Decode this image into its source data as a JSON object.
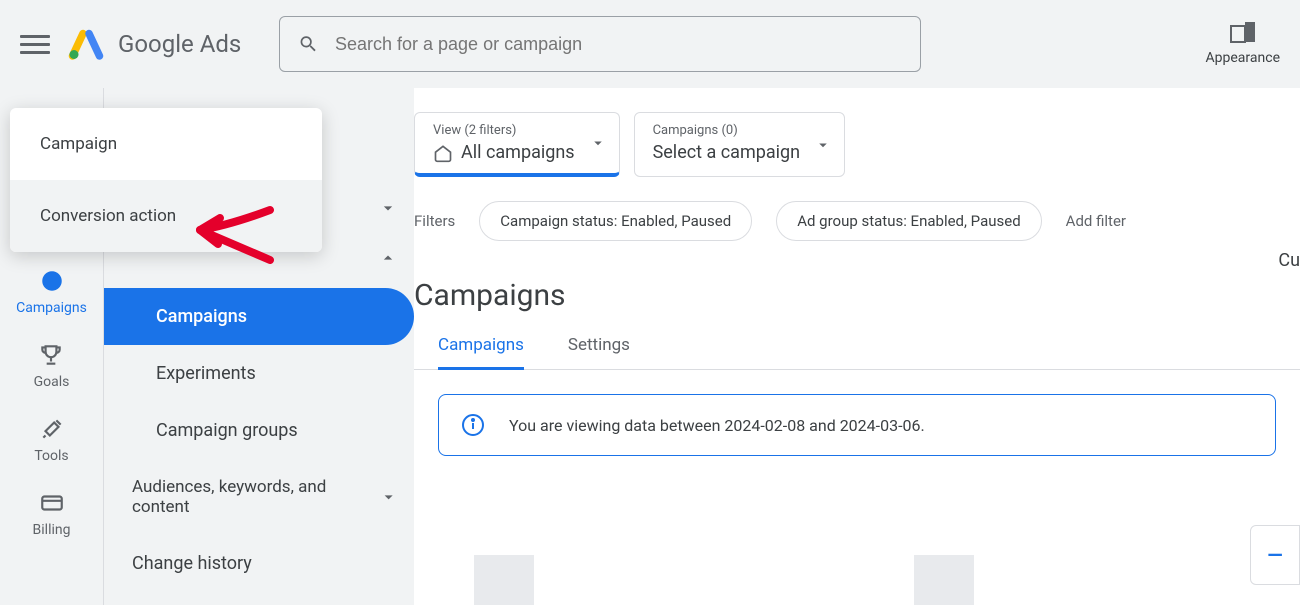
{
  "header": {
    "product_name": "Google Ads",
    "search_placeholder": "Search for a page or campaign",
    "appearance_label": "Appearance"
  },
  "iconrail": {
    "campaigns": "Campaigns",
    "goals": "Goals",
    "tools": "Tools",
    "billing": "Billing"
  },
  "secondnav": {
    "campaigns": "Campaigns",
    "experiments": "Experiments",
    "campaign_groups": "Campaign groups",
    "audiences": "Audiences, keywords, and content",
    "change_history": "Change history"
  },
  "popup": {
    "item1": "Campaign",
    "item2": "Conversion action"
  },
  "view_card": {
    "small": "View (2 filters)",
    "big": "All campaigns"
  },
  "campaign_card": {
    "small": "Campaigns (0)",
    "big": "Select a campaign"
  },
  "filters": {
    "label": "Filters",
    "chip1": "Campaign status: Enabled, Paused",
    "chip2": "Ad group status: Enabled, Paused",
    "add": "Add filter"
  },
  "page_title": "Campaigns",
  "edge_text": "Cu",
  "tabs": {
    "campaigns": "Campaigns",
    "settings": "Settings"
  },
  "info_message": "You are viewing data between 2024-02-08 and 2024-03-06.",
  "plotbox_glyph": "—"
}
